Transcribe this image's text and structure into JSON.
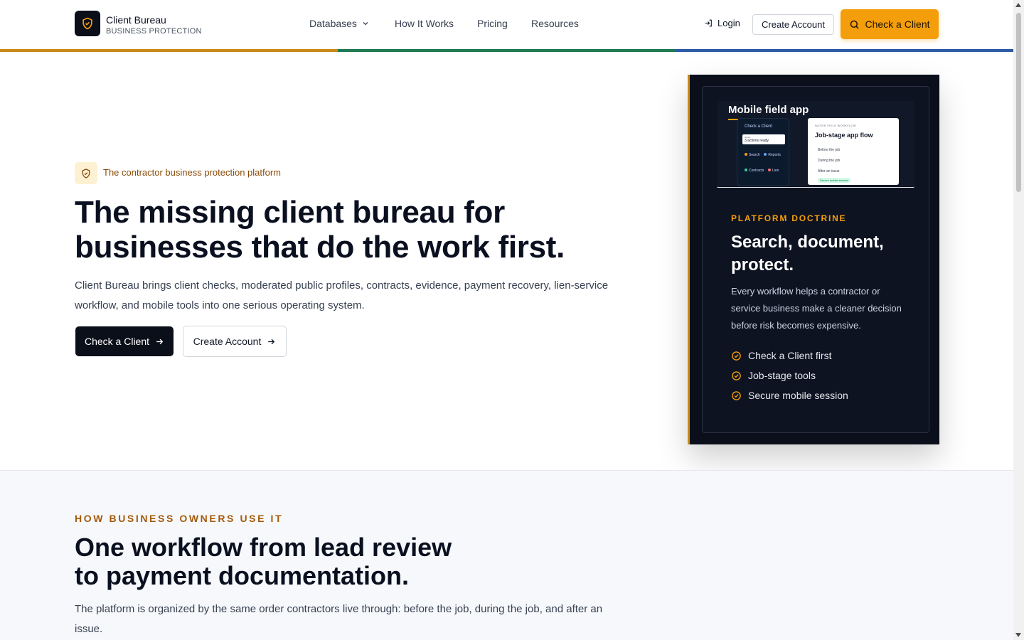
{
  "header": {
    "brand_name": "Client Bureau",
    "brand_sub": "BUSINESS PROTECTION",
    "nav": [
      "Databases",
      "How It Works",
      "Pricing",
      "Resources"
    ],
    "login": "Login",
    "create_account": "Create Account",
    "check_client": "Check a Client"
  },
  "colors": {
    "accent": "#f59e0b",
    "dark": "#0b0f19",
    "stripe": [
      "#c98a1b",
      "#1f7a52",
      "#2d5aa7"
    ]
  },
  "hero": {
    "badge": "The contractor business protection platform",
    "title_line1": "The missing client bureau for",
    "title_line2": "businesses that do the work first.",
    "description": "Client Bureau brings client checks, moderated public profiles, contracts, evidence, payment recovery, lien-service workflow, and mobile tools into one serious operating system.",
    "primary_button": "Check a Client",
    "secondary_button": "Create Account"
  },
  "card": {
    "mock_title": "Mobile field app",
    "phone": {
      "header": "Check a Client",
      "input_label": "Ready",
      "input_value": "3 actions ready",
      "items": [
        "Search",
        "Reports",
        "Contracts",
        "Lien"
      ]
    },
    "flow": {
      "tag": "NATIVE FIELD WORKFLOW",
      "title": "Job-stage app flow",
      "items": [
        "Before the job",
        "During the job",
        "After an issue"
      ],
      "pill": "Secure mobile session"
    },
    "label": "PLATFORM DOCTRINE",
    "title": "Search, document, protect.",
    "description": "Every workflow helps a contractor or service business make a cleaner decision before risk becomes expensive.",
    "checks": [
      "Check a Client first",
      "Job-stage tools",
      "Secure mobile session"
    ]
  },
  "section2": {
    "label": "HOW BUSINESS OWNERS USE IT",
    "title_line1": "One workflow from lead review",
    "title_line2": "to payment documentation.",
    "description": "The platform is organized by the same order contractors live through: before the job, during the job, and after an issue."
  }
}
